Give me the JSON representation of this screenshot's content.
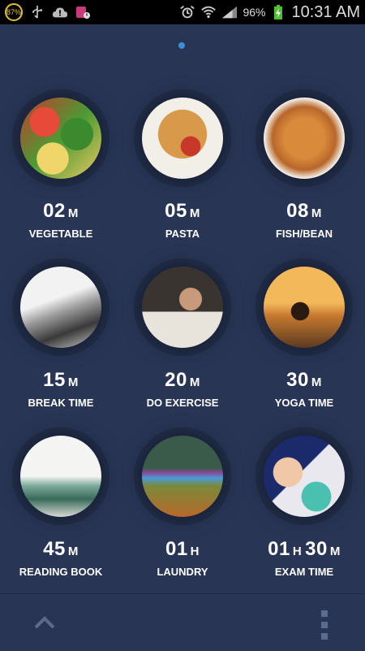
{
  "status_bar": {
    "badge_text": "87%",
    "battery_text": "96%",
    "time": "10:31 AM"
  },
  "items": [
    {
      "number": "02",
      "unit": "M",
      "label": "VEGETABLE",
      "image": "vegetable-photo"
    },
    {
      "number": "05",
      "unit": "M",
      "label": "PASTA",
      "image": "pasta-photo"
    },
    {
      "number": "08",
      "unit": "M",
      "label": "FISH/BEAN",
      "image": "fish-bean-photo"
    },
    {
      "number": "15",
      "unit": "M",
      "label": "BREAK TIME",
      "image": "glasses-photo"
    },
    {
      "number": "20",
      "unit": "M",
      "label": "DO EXERCISE",
      "image": "studying-photo"
    },
    {
      "number": "30",
      "unit": "M",
      "label": "YOGA TIME",
      "image": "yoga-photo"
    },
    {
      "number": "45",
      "unit": "M",
      "label": "READING BOOK",
      "image": "room-photo"
    },
    {
      "number": "01",
      "unit": "H",
      "label": "LAUNDRY",
      "image": "laundry-photo"
    },
    {
      "number": "01",
      "unit": "H",
      "number2": "30",
      "unit2": "M",
      "label": "EXAM TIME",
      "image": "drawing-photo"
    }
  ],
  "icons": {
    "up": "chevron-up-icon",
    "menu": "overflow-menu-icon"
  },
  "colors": {
    "background": "#283555",
    "page_indicator": "#3e8fd8",
    "text": "#ffffff"
  }
}
